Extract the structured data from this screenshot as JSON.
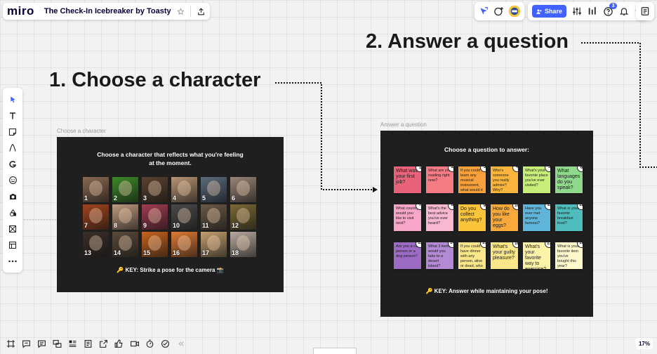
{
  "app": {
    "logo": "miro",
    "board_title": "The Check-In Icebreaker by Toasty"
  },
  "toolbar": {
    "share_label": "Share",
    "notification_count": "3",
    "zoom": "17%"
  },
  "canvas": {
    "heading1": "1.  Choose a character",
    "heading2": "2. Answer a question",
    "frame1": {
      "label": "Choose a character",
      "heading_line1": "Choose a character that reflects what you're feeling",
      "heading_line2": "at the moment.",
      "key": "🔑 KEY: Strike a pose for the camera 📸",
      "characters": [
        {
          "num": "1",
          "color": "#8a6a52"
        },
        {
          "num": "2",
          "color": "#3d8a2a"
        },
        {
          "num": "3",
          "color": "#5a4230"
        },
        {
          "num": "4",
          "color": "#b89575"
        },
        {
          "num": "5",
          "color": "#5b6a7c"
        },
        {
          "num": "6",
          "color": "#9a8478"
        },
        {
          "num": "7",
          "color": "#a0451e"
        },
        {
          "num": "8",
          "color": "#c09a80"
        },
        {
          "num": "9",
          "color": "#a23b52"
        },
        {
          "num": "10",
          "color": "#4a4a4a"
        },
        {
          "num": "11",
          "color": "#6a5a48"
        },
        {
          "num": "12",
          "color": "#7c6a36"
        },
        {
          "num": "13",
          "color": "#3a2e2a"
        },
        {
          "num": "14",
          "color": "#5a4a3c"
        },
        {
          "num": "15",
          "color": "#c8641e"
        },
        {
          "num": "16",
          "color": "#e07a34"
        },
        {
          "num": "17",
          "color": "#c4a070"
        },
        {
          "num": "18",
          "color": "#b9a9a0"
        }
      ]
    },
    "frame2": {
      "label": "Answer a question",
      "heading": "Choose a question to answer:",
      "key": "🔑 KEY: Answer while maintaining your pose!",
      "questions": [
        {
          "num": "1",
          "text": "What was your first job?",
          "color": "#e8637a",
          "size": "big"
        },
        {
          "num": "2",
          "text": "What are you reading right now?",
          "color": "#f57b85",
          "size": "small"
        },
        {
          "num": "3",
          "text": "If you could learn any musical instrument, what would it be and why?",
          "color": "#f8a03c",
          "size": "small"
        },
        {
          "num": "4",
          "text": "Who's someone you really admire? Why?",
          "color": "#fbb53c",
          "size": "small"
        },
        {
          "num": "5",
          "text": "What's your favorite place you've ever visited?",
          "color": "#c8ee7a",
          "size": "small"
        },
        {
          "num": "6",
          "text": "What languages do you speak?",
          "color": "#8fd98c",
          "size": "big"
        },
        {
          "num": "7",
          "text": "What country would you like to visit next?",
          "color": "#f7a6c8",
          "size": "small"
        },
        {
          "num": "8",
          "text": "What's the best advice you've ever heard?",
          "color": "#f8b8d0",
          "size": "small"
        },
        {
          "num": "9",
          "text": "Do you collect anything?",
          "color": "#fbc43a",
          "size": "big"
        },
        {
          "num": "10",
          "text": "How do you like your eggs?",
          "color": "#f8a93a",
          "size": "big"
        },
        {
          "num": "11",
          "text": "Have you ever met anyone famous?",
          "color": "#5fb4d9",
          "size": "small"
        },
        {
          "num": "12",
          "text": "What is your favorite breakfast food?",
          "color": "#4fbdbd",
          "size": "small"
        },
        {
          "num": "13",
          "text": "Are you a cat person or a dog person?",
          "color": "#9c6bc4",
          "size": "small"
        },
        {
          "num": "14",
          "text": "What 3 items would you take to a desert island?",
          "color": "#b48ad6",
          "size": "small"
        },
        {
          "num": "15",
          "text": "If you could have dinner with any person, alive or dead, who would it be?",
          "color": "#fbe78a",
          "size": "small"
        },
        {
          "num": "16",
          "text": "What's your guilty pleasure?",
          "color": "#fbe78a",
          "size": "big"
        },
        {
          "num": "17",
          "text": "What's your favorite way to exercise?",
          "color": "#fdf3a8",
          "size": "big"
        },
        {
          "num": "18",
          "text": "What is your favorite item you've bought this year?",
          "color": "#fdf7cc",
          "size": "small"
        }
      ]
    }
  },
  "colors": {
    "accent": "#4262ff",
    "frame_bg": "#1f1f1f",
    "connector": "#111111"
  }
}
